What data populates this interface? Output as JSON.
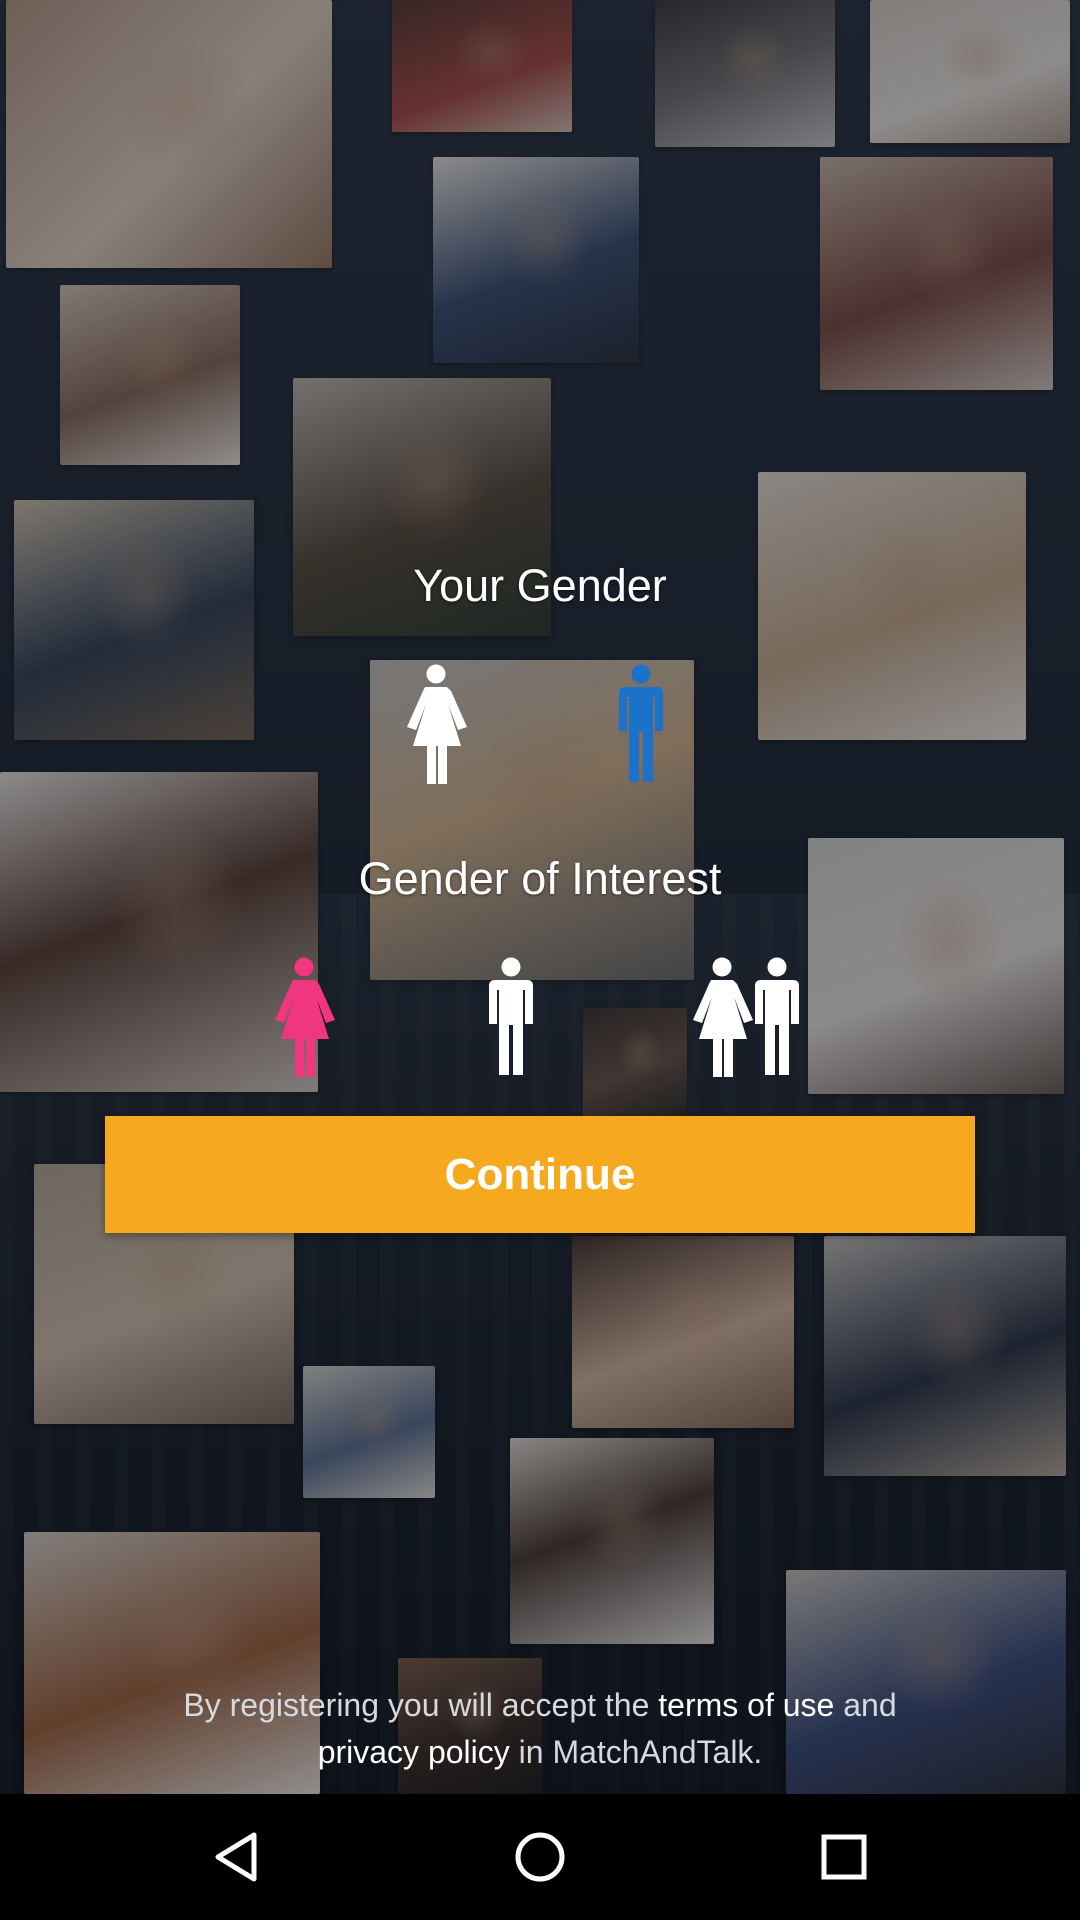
{
  "gender": {
    "title": "Your Gender",
    "options": [
      {
        "id": "female",
        "selected": false,
        "color": "#ffffff"
      },
      {
        "id": "male",
        "selected": true,
        "color": "#1a73c9"
      }
    ]
  },
  "interest": {
    "title": "Gender of Interest",
    "options": [
      {
        "id": "female",
        "selected": true,
        "color": "#f0367f"
      },
      {
        "id": "male",
        "selected": false,
        "color": "#ffffff"
      },
      {
        "id": "both",
        "selected": false,
        "color": "#ffffff"
      }
    ]
  },
  "continue_label": "Continue",
  "legal": {
    "prefix": "By registering you will accept the",
    "terms": "terms of use",
    "and": "and",
    "privacy": "privacy policy",
    "suffix": "in MatchAndTalk."
  },
  "colors": {
    "accent": "#f6a81f",
    "selected_male": "#1a73c9",
    "selected_female": "#f0367f"
  },
  "navbar": {
    "icons": [
      "back-icon",
      "home-icon",
      "recents-icon"
    ]
  }
}
